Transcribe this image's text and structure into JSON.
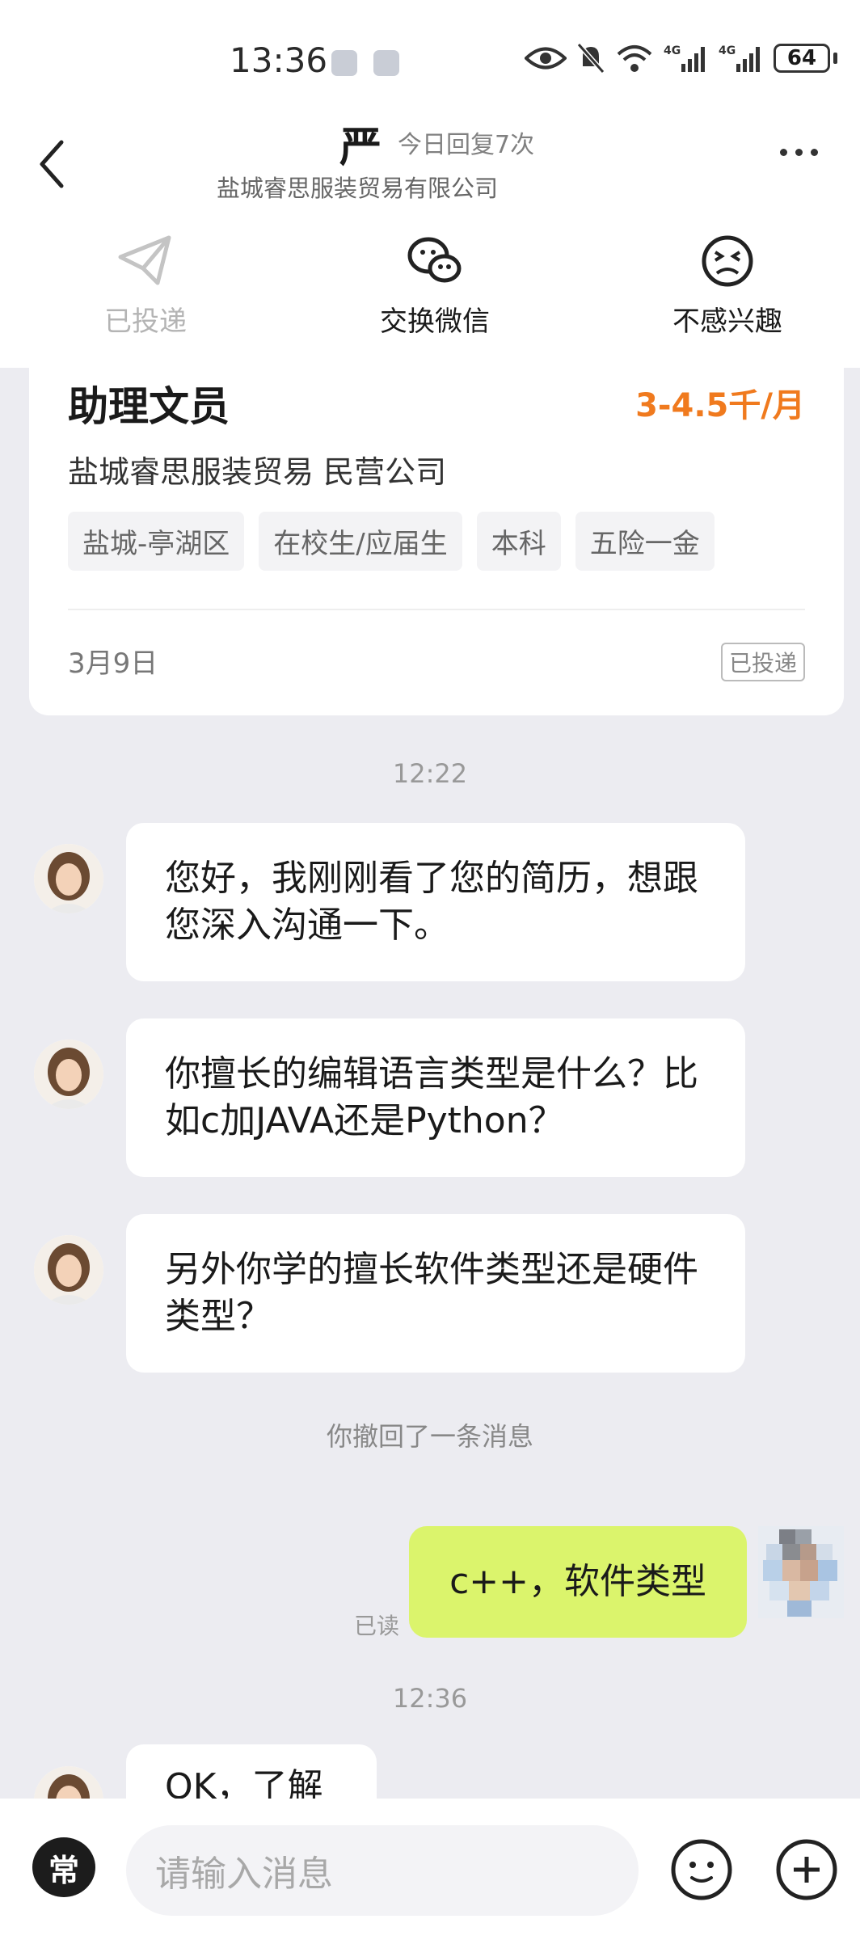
{
  "status_bar": {
    "time": "13:36",
    "battery": "64"
  },
  "header": {
    "name": "严",
    "reply_info": "今日回复7次",
    "company": "盐城睿思服装贸易有限公司"
  },
  "actions": [
    {
      "label": "已投递",
      "icon": "paper-plane-icon"
    },
    {
      "label": "交换微信",
      "icon": "wechat-icon"
    },
    {
      "label": "不感兴趣",
      "icon": "frown-icon"
    }
  ],
  "job_card": {
    "title": "助理文员",
    "salary": "3-4.5千/月",
    "company_line": "盐城睿思服装贸易  民营公司",
    "tags": [
      "盐城-亭湖区",
      "在校生/应届生",
      "本科",
      "五险一金"
    ],
    "date": "3月9日",
    "status_badge": "已投递"
  },
  "chat": {
    "time1": "12:22",
    "messages_in": [
      "您好，我刚刚看了您的简历，想跟您深入沟通一下。",
      "你擅长的编辑语言类型是什么？比如c加JAVA还是Python？",
      "另外你学的擅长软件类型还是硬件类型？"
    ],
    "recall_notice": "你撤回了一条消息",
    "message_out": "c++，软件类型",
    "read_status": "已读",
    "time2": "12:36",
    "partial_message": "OK，了解"
  },
  "input_bar": {
    "quick_label": "常",
    "placeholder": "请输入消息"
  },
  "colors": {
    "accent_orange": "#f07a1e",
    "out_bubble": "#dbf46c"
  }
}
